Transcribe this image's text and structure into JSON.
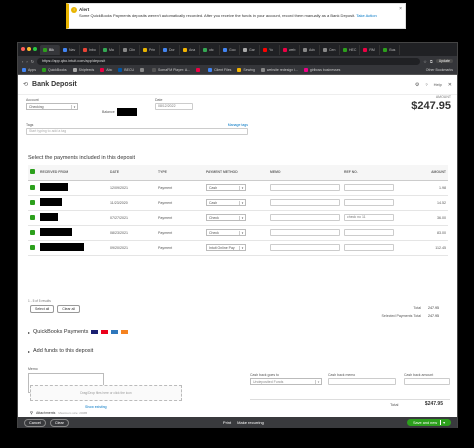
{
  "alert": {
    "title": "Alert",
    "message": "Some QuickBooks Payments deposits weren't automatically recorded. After you receive the funds in your account, record them manually as a Bank Deposit.",
    "link": "Take Action",
    "close": "×"
  },
  "browser": {
    "tabs": [
      {
        "label": "Blk",
        "color": "#2ca01c"
      },
      {
        "label": "Nav",
        "color": "#4285f4"
      },
      {
        "label": "Inbo",
        "color": "#ea4335"
      },
      {
        "label": "Ma",
        "color": "#34a853"
      },
      {
        "label": "Clin",
        "color": "#888"
      },
      {
        "label": "Prin",
        "color": "#e8b400"
      },
      {
        "label": "Dor",
        "color": "#4285f4"
      },
      {
        "label": "Ana",
        "color": "#f4b400"
      },
      {
        "label": "otc",
        "color": "#34a853"
      },
      {
        "label": "Goo",
        "color": "#4285f4"
      },
      {
        "label": "Gar",
        "color": "#aaa"
      },
      {
        "label": "Yo",
        "color": "#ff0000"
      },
      {
        "label": "web",
        "color": "#e04"
      },
      {
        "label": "Adv",
        "color": "#888"
      },
      {
        "label": "Cen",
        "color": "#888"
      },
      {
        "label": "HEC",
        "color": "#2ca01c"
      },
      {
        "label": "RM",
        "color": "#e04"
      },
      {
        "label": "Bus",
        "color": "#2ca01c"
      }
    ],
    "url": "https://app.qbo.intuit.com/app/deposit",
    "update": "Update",
    "bookmarks": [
      {
        "label": "Apps",
        "color": "#4285f4"
      },
      {
        "label": "QuickBooks",
        "color": "#2ca01c"
      },
      {
        "label": "Shipfeeds",
        "color": "#aaa"
      },
      {
        "label": "Abc",
        "color": "#e04"
      },
      {
        "label": "BECU",
        "color": "#0055a5"
      },
      {
        "label": "",
        "color": "#888"
      },
      {
        "label": "SomaFM Player: A...",
        "color": "#555"
      },
      {
        "label": "",
        "color": "#e04"
      },
      {
        "label": "Client Files",
        "color": "#4285f4"
      },
      {
        "label": "Sewing",
        "color": "#f4b400"
      },
      {
        "label": "website redesign i...",
        "color": "#888"
      },
      {
        "label": "girlboss businesses",
        "color": "#e08"
      }
    ],
    "other_bookmarks": "Other Bookmarks"
  },
  "page": {
    "title": "Bank Deposit",
    "help": "Help",
    "account_label": "Account",
    "account_value": "Checking",
    "balance_label": "Balance",
    "date_label": "Date",
    "date_value": "08/12/2022",
    "amount_label": "AMOUNT",
    "amount": "$247.95",
    "tags_label": "Tags",
    "manage_tags": "Manage tags",
    "tags_placeholder": "Start typing to add a tag",
    "payments_title": "Select the payments included in this deposit",
    "columns": [
      "RECEIVED FROM",
      "DATE",
      "TYPE",
      "PAYMENT METHOD",
      "MEMO",
      "REF NO.",
      "AMOUNT"
    ],
    "rows": [
      {
        "date": "12/09/2021",
        "type": "Payment",
        "method": "Cash",
        "ref": "",
        "amount": "1.98"
      },
      {
        "date": "11/23/2020",
        "type": "Payment",
        "method": "Cash",
        "ref": "",
        "amount": "14.52"
      },
      {
        "date": "07/27/2021",
        "type": "Payment",
        "method": "Check",
        "ref": "check no 11",
        "amount": "36.00"
      },
      {
        "date": "08/23/2021",
        "type": "Payment",
        "method": "Check",
        "ref": "",
        "amount": "83.00"
      },
      {
        "date": "09/20/2021",
        "type": "Payment",
        "method": "Intuit Online Pay",
        "ref": "",
        "amount": "112.45"
      }
    ],
    "pager": "1 - 5 of 5 results",
    "select_all": "Select all",
    "clear_all": "Clear all",
    "total_label": "Total",
    "total_value": "247.95",
    "selected_label": "Selected Payments Total",
    "selected_value": "247.95",
    "qb_payments": "QuickBooks Payments",
    "add_funds": "Add funds to this deposit",
    "memo_label": "Memo",
    "cashback_goes_label": "Cash back goes to",
    "cashback_goes_placeholder": "Undeposited Funds",
    "cashback_memo_label": "Cash back memo",
    "cashback_amount_label": "Cash back amount",
    "grand_total_label": "Total",
    "grand_total": "$247.95",
    "attachments_label": "Attachments",
    "attachments_max": "Maximum size: 20MB",
    "drop_text": "Drag/Drop files here or click the icon",
    "show_existing": "Show existing"
  },
  "footer": {
    "cancel": "Cancel",
    "clear": "Clear",
    "print": "Print",
    "recurring": "Make recurring",
    "save": "Save and new"
  }
}
